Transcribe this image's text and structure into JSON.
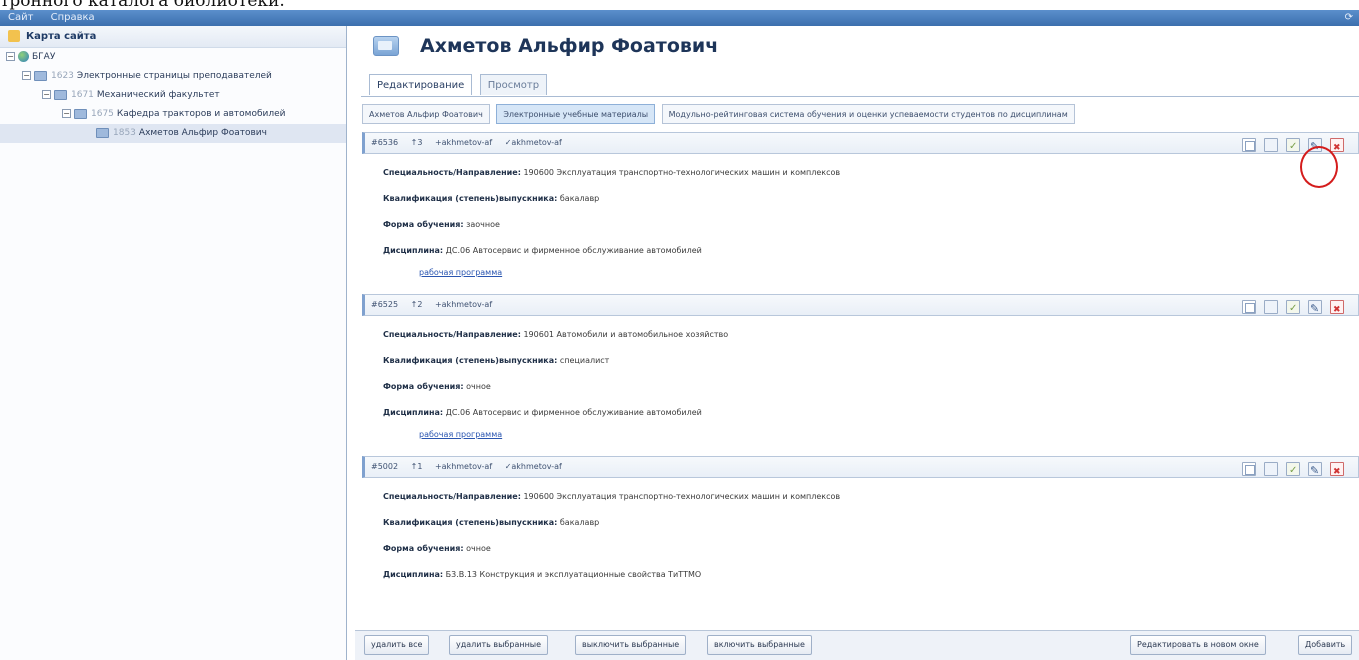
{
  "page_caption": "тронного каталога библиотеки.",
  "menu": {
    "items": [
      "Сайт",
      "Справка"
    ]
  },
  "sidebar": {
    "title": "Карта сайта",
    "tree": [
      {
        "num": "",
        "label": "БГАУ",
        "level": 0
      },
      {
        "num": "1623",
        "label": "Электронные страницы преподавателей",
        "level": 1
      },
      {
        "num": "1671",
        "label": "Механический факультет",
        "level": 2
      },
      {
        "num": "1675",
        "label": "Кафедра тракторов и автомобилей",
        "level": 3
      },
      {
        "num": "1853",
        "label": "Ахметов Альфир Фоатович",
        "level": 4,
        "selected": true
      }
    ]
  },
  "page": {
    "title": "Ахметов Альфир Фоатович"
  },
  "mode_tabs": [
    "Редактирование",
    "Просмотр"
  ],
  "sub_tabs": [
    {
      "label": "Ахметов Альфир Фоатович"
    },
    {
      "label": "Электронные учебные материалы",
      "active": true
    },
    {
      "label": "Модульно-рейтинговая система обучения и оценки успеваемости студентов по дисциплинам"
    }
  ],
  "labels": {
    "specialty": "Специальность/Направление:",
    "qualification": "Квалификация (степень)выпускника:",
    "study_form": "Форма обучения:",
    "discipline": "Дисциплина:"
  },
  "records": [
    {
      "id": "6536",
      "order": "3",
      "creator": "akhmetov-af",
      "editor": "akhmetov-af",
      "specialty": "190600 Эксплуатация транспортно-технологических машин и комплексов",
      "qualification": "бакалавр",
      "study_form": "заочное",
      "discipline": "ДС.06 Автосервис и фирменное обслуживание автомобилей",
      "link": "рабочая программа"
    },
    {
      "id": "6525",
      "order": "2",
      "creator": "akhmetov-af",
      "editor": "",
      "specialty": "190601 Автомобили и автомобильное хозяйство",
      "qualification": "специалист",
      "study_form": "очное",
      "discipline": "ДС.06 Автосервис и фирменное обслуживание автомобилей",
      "link": "рабочая программа"
    },
    {
      "id": "5002",
      "order": "1",
      "creator": "akhmetov-af",
      "editor": "akhmetov-af",
      "specialty": "190600 Эксплуатация транспортно-технологических машин и комплексов",
      "qualification": "бакалавр",
      "study_form": "очное",
      "discipline": "Б3.В.13 Конструкция и эксплуатационные свойства ТиТТМО",
      "link": ""
    }
  ],
  "bottom": {
    "delete_all": "удалить все",
    "delete_selected": "удалить выбранные",
    "disable_selected": "выключить выбранные",
    "enable_selected": "включить выбранные",
    "edit_new_window": "Редактировать в новом окне",
    "add": "Добавить"
  },
  "colors": {
    "menubar": "#3c6fad",
    "accent": "#7fa1cf",
    "annotation_ring": "#d41c1c"
  }
}
